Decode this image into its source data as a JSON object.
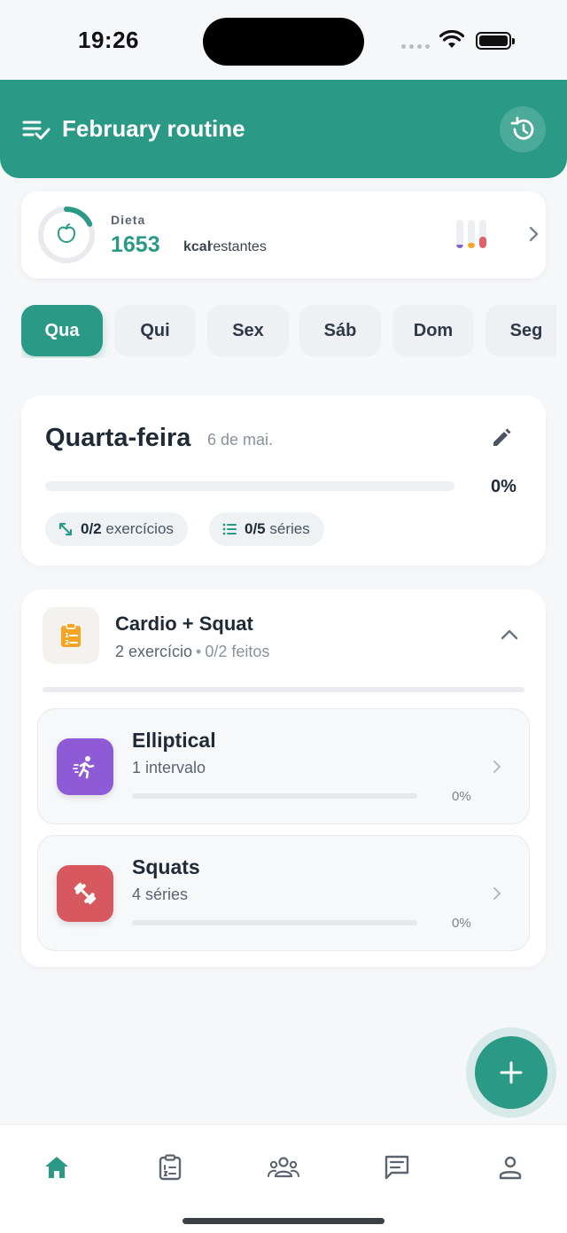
{
  "status_bar": {
    "time": "19:26"
  },
  "header": {
    "title": "February routine"
  },
  "diet": {
    "label": "Dieta",
    "calories": "1653",
    "unit": "kcal",
    "suffix": "restantes",
    "ring_progress": 0.18,
    "macros": [
      {
        "name": "protein",
        "color": "#8a63d2",
        "fill": 0.12
      },
      {
        "name": "carbs",
        "color": "#f5a524",
        "fill": 0.2
      },
      {
        "name": "fat",
        "color": "#e0606a",
        "fill": 0.4
      }
    ]
  },
  "days": [
    {
      "label": "Qua",
      "active": true
    },
    {
      "label": "Qui",
      "active": false
    },
    {
      "label": "Sex",
      "active": false
    },
    {
      "label": "Sáb",
      "active": false
    },
    {
      "label": "Dom",
      "active": false
    },
    {
      "label": "Seg",
      "active": false
    }
  ],
  "day_card": {
    "title": "Quarta-feira",
    "date": "6 de mai.",
    "progress_pct": "0%",
    "exercises_count": "0/2",
    "exercises_label": "exercícios",
    "sets_count": "0/5",
    "sets_label": "séries"
  },
  "workout": {
    "title": "Cardio + Squat",
    "count": "2 exercício",
    "separator": "•",
    "done": "0/2 feitos",
    "exercises": [
      {
        "name": "Elliptical",
        "meta": "1 intervalo",
        "pct": "0%",
        "color": "#8e5ad6",
        "icon": "running-icon"
      },
      {
        "name": "Squats",
        "meta": "4 séries",
        "pct": "0%",
        "color": "#d8585f",
        "icon": "dumbbell-icon"
      }
    ]
  },
  "colors": {
    "accent": "#2a9a86"
  }
}
